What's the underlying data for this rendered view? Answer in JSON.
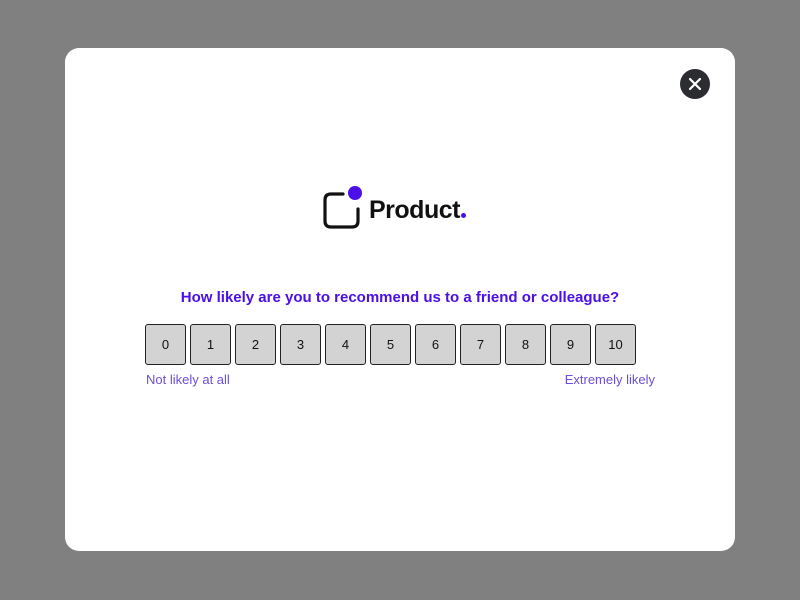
{
  "modal": {
    "close_icon": "close-icon"
  },
  "logo": {
    "text": "Product",
    "icon": "product-logo-icon"
  },
  "survey": {
    "question": "How likely are you to recommend us to a friend or colleague?",
    "scores": [
      "0",
      "1",
      "2",
      "3",
      "4",
      "5",
      "6",
      "7",
      "8",
      "9",
      "10"
    ],
    "low_label": "Not likely at all",
    "high_label": "Extremely likely"
  },
  "colors": {
    "backdrop": "#808080",
    "accent": "#4b0fe8",
    "label": "#6a4fd8",
    "button_bg": "#d3d3d3"
  }
}
